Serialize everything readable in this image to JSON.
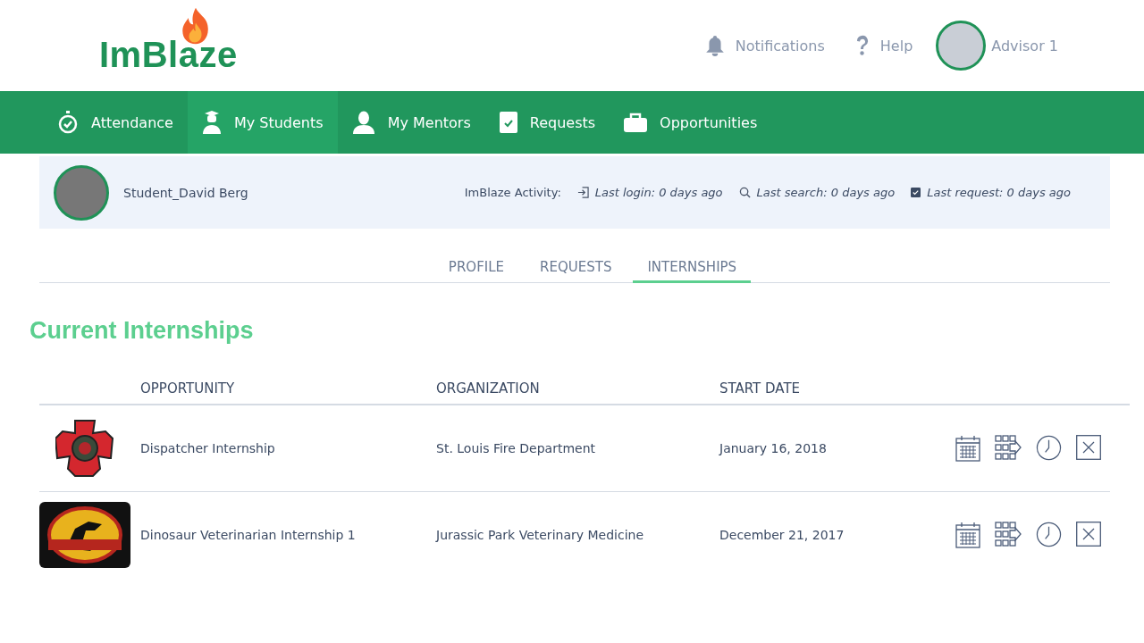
{
  "header": {
    "logo": "ImBlaze",
    "links": [
      {
        "kind": "bell",
        "label": "Notifications"
      },
      {
        "kind": "help",
        "label": "Help"
      }
    ],
    "user": {
      "name": "Advisor 1"
    }
  },
  "nav": [
    {
      "kind": "stopwatch",
      "label": "Attendance",
      "selected": false
    },
    {
      "kind": "student",
      "label": "My Students",
      "selected": true
    },
    {
      "kind": "person",
      "label": "My Mentors",
      "selected": false
    },
    {
      "kind": "check",
      "label": "Requests",
      "selected": false
    },
    {
      "kind": "briefcase",
      "label": "Opportunities",
      "selected": false
    }
  ],
  "student": {
    "name": "Student_David Berg",
    "activity_label": "ImBlaze Activity:",
    "activity": [
      {
        "kind": "login",
        "text": "Last login: 0 days ago"
      },
      {
        "kind": "search",
        "text": "Last search: 0 days ago"
      },
      {
        "kind": "request",
        "text": "Last request: 0 days ago"
      }
    ]
  },
  "tabs": [
    {
      "label": "PROFILE",
      "selected": false
    },
    {
      "label": "REQUESTS",
      "selected": false
    },
    {
      "label": "INTERNSHIPS",
      "selected": true
    }
  ],
  "section_title": "Current Internships",
  "table": {
    "columns": [
      "OPPORTUNITY",
      "ORGANIZATION",
      "START DATE"
    ],
    "rows": [
      {
        "kind": "fire",
        "opportunity": "Dispatcher Internship",
        "organization": "St. Louis Fire Department",
        "start_date": "January 16, 2018"
      },
      {
        "kind": "dinosaur",
        "opportunity": "Dinosaur Veterinarian Internship 1",
        "organization": "Jurassic Park Veterinary Medicine",
        "start_date": "December 21, 2017"
      }
    ]
  }
}
